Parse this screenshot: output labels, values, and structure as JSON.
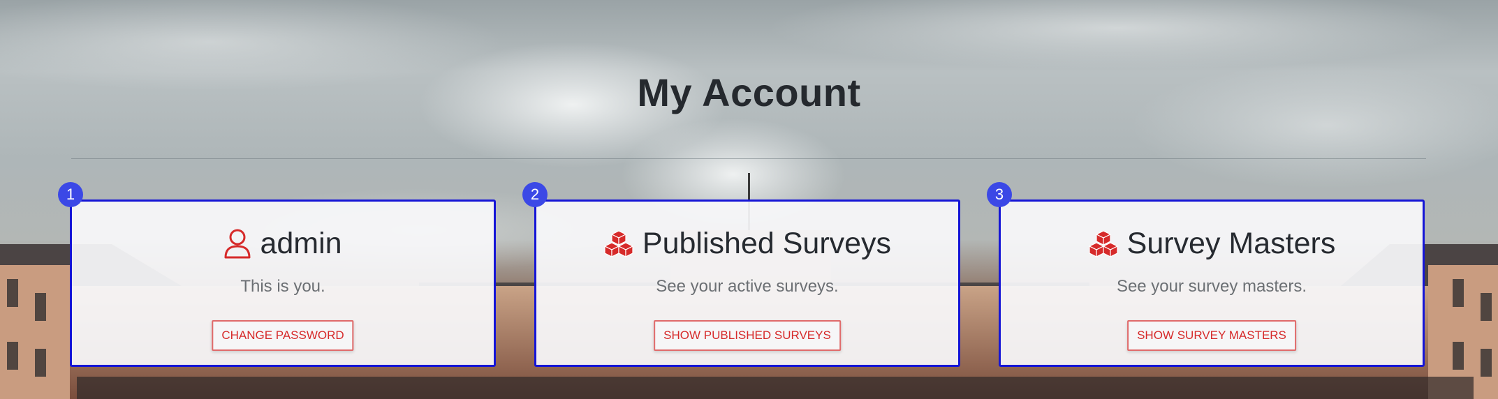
{
  "page": {
    "title": "My Account"
  },
  "colors": {
    "accent": "#d62a2a",
    "highlight_border": "#1515d6",
    "badge": "#3b48e6"
  },
  "cards": [
    {
      "badge": "1",
      "icon": "user-icon",
      "title": "admin",
      "text": "This is you.",
      "button": "CHANGE PASSWORD"
    },
    {
      "badge": "2",
      "icon": "cubes-icon",
      "title": "Published Surveys",
      "text": "See your active surveys.",
      "button": "SHOW PUBLISHED SURVEYS"
    },
    {
      "badge": "3",
      "icon": "cubes-icon",
      "title": "Survey Masters",
      "text": "See your survey masters.",
      "button": "SHOW SURVEY MASTERS"
    }
  ]
}
